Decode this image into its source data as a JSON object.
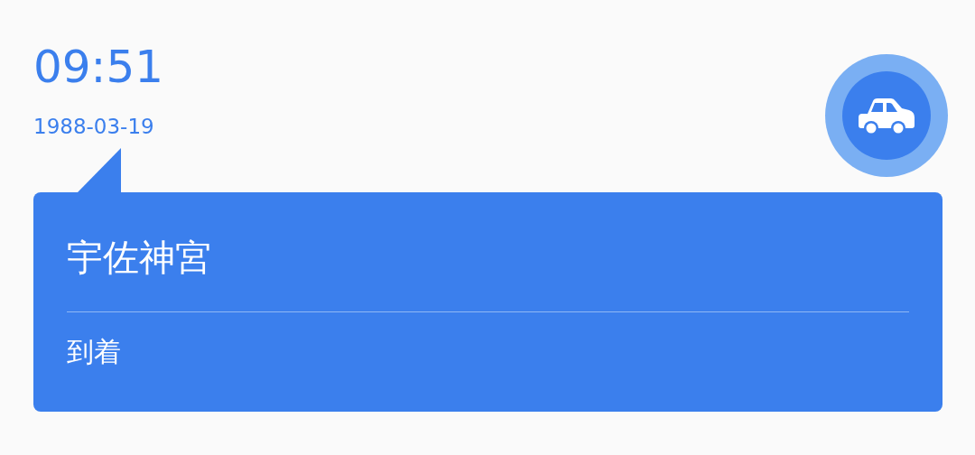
{
  "time": "09:51",
  "date": "1988-03-19",
  "event": {
    "title": "宇佐神宮",
    "status": "到着"
  }
}
